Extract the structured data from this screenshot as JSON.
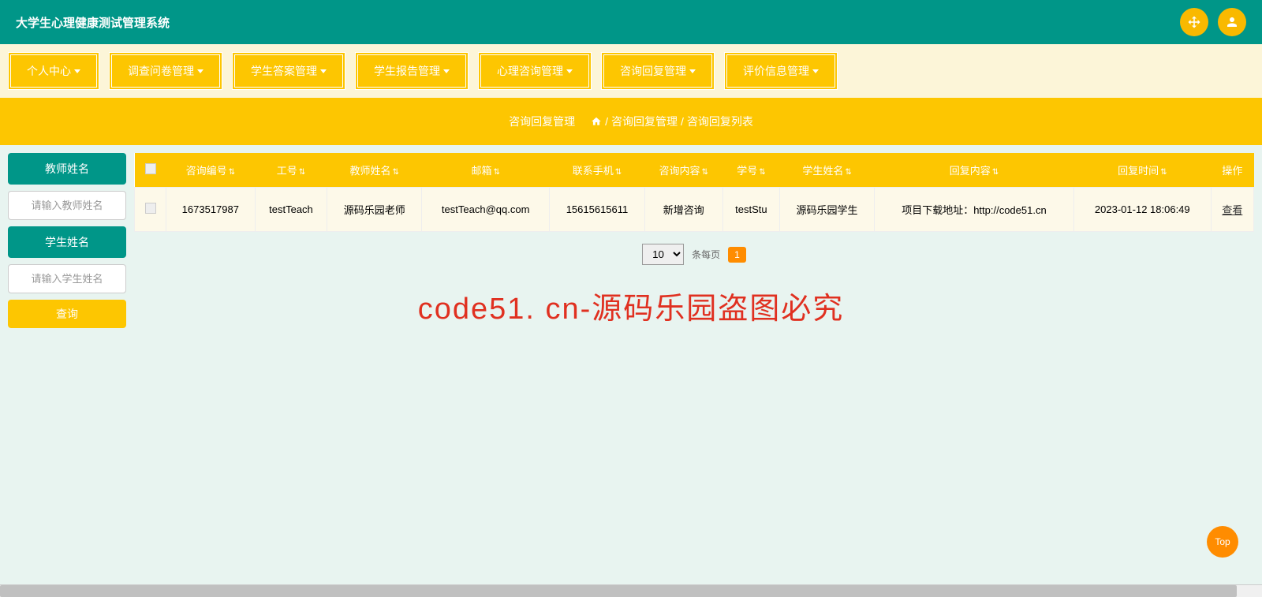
{
  "header": {
    "title": "大学生心理健康测试管理系统"
  },
  "nav": [
    "个人中心",
    "调查问卷管理",
    "学生答案管理",
    "学生报告管理",
    "心理咨询管理",
    "咨询回复管理",
    "评价信息管理"
  ],
  "breadcrumb": {
    "title": "咨询回复管理",
    "path1": "咨询回复管理",
    "path2": "咨询回复列表",
    "sep": "/"
  },
  "sidebar": {
    "teacher_label": "教师姓名",
    "teacher_placeholder": "请输入教师姓名",
    "student_label": "学生姓名",
    "student_placeholder": "请输入学生姓名",
    "search": "查询"
  },
  "table": {
    "headers": {
      "consult_no": "咨询编号",
      "job_no": "工号",
      "teacher_name": "教师姓名",
      "email": "邮箱",
      "phone": "联系手机",
      "consult_content": "咨询内容",
      "student_no": "学号",
      "student_name": "学生姓名",
      "reply_content": "回复内容",
      "reply_time": "回复时间",
      "action": "操作"
    },
    "rows": [
      {
        "consult_no": "1673517987",
        "job_no": "testTeach",
        "teacher_name": "源码乐园老师",
        "email": "testTeach@qq.com",
        "phone": "15615615611",
        "consult_content": "新增咨询",
        "student_no": "testStu",
        "student_name": "源码乐园学生",
        "reply_content": "项目下载地址：http://code51.cn",
        "reply_time": "2023-01-12 18:06:49",
        "action": "查看"
      }
    ]
  },
  "pagination": {
    "page_size": "10",
    "label": "条每页",
    "current": "1"
  },
  "watermark": "code51. cn-源码乐园盗图必究",
  "top_button": "Top"
}
